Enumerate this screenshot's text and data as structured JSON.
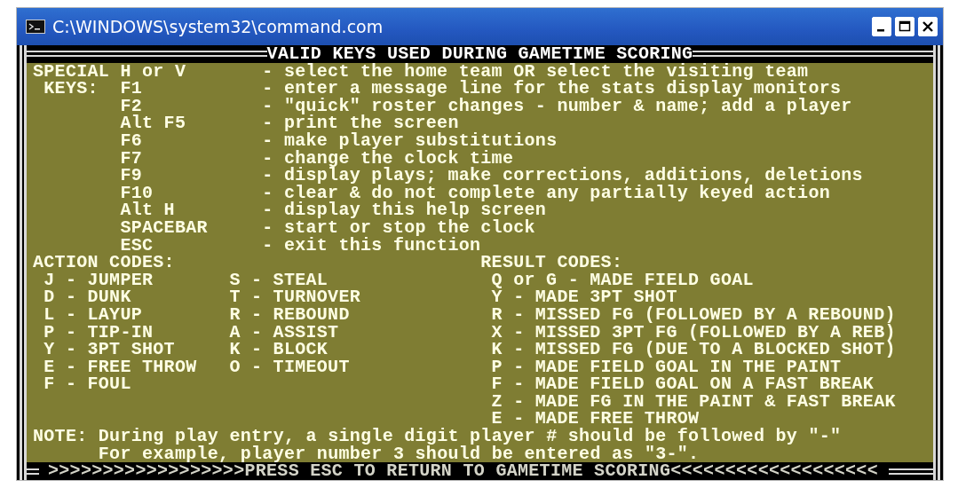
{
  "window": {
    "title": "C:\\WINDOWS\\system32\\command.com"
  },
  "screen": {
    "heading": "VALID KEYS USED DURING GAMETIME SCORING",
    "special_keys": {
      "label_lines": [
        "SPECIAL",
        "KEYS:"
      ],
      "rows": [
        {
          "key": "H or V",
          "description": "- select the home team OR select the visiting team"
        },
        {
          "key": "F1",
          "description": "- enter a message line for the stats display monitors"
        },
        {
          "key": "F2",
          "description": "- \"quick\" roster changes - number & name; add a player"
        },
        {
          "key": "Alt F5",
          "description": "- print the screen"
        },
        {
          "key": "F6",
          "description": "- make player substitutions"
        },
        {
          "key": "F7",
          "description": "- change the clock time"
        },
        {
          "key": "F9",
          "description": "- display plays; make corrections, additions, deletions"
        },
        {
          "key": "F10",
          "description": "- clear & do not complete any partially keyed action"
        },
        {
          "key": "Alt H",
          "description": "- display this help screen"
        },
        {
          "key": "SPACEBAR",
          "description": "- start or stop the clock"
        },
        {
          "key": "ESC",
          "description": "- exit this function"
        }
      ]
    },
    "action_codes": {
      "heading": "ACTION CODES:",
      "column_1": [
        "J - JUMPER",
        "D - DUNK",
        "L - LAYUP",
        "P - TIP-IN",
        "Y - 3PT SHOT",
        "E - FREE THROW",
        "F - FOUL"
      ],
      "column_2": [
        "S - STEAL",
        "T - TURNOVER",
        "R - REBOUND",
        "A - ASSIST",
        "K - BLOCK",
        "O - TIMEOUT"
      ]
    },
    "result_codes": {
      "heading": "RESULT CODES:",
      "items": [
        "Q or G - MADE FIELD GOAL",
        "Y - MADE 3PT SHOT",
        "R - MISSED FG (FOLLOWED BY A REBOUND)",
        "X - MISSED 3PT FG (FOLLOWED BY A REB)",
        "K - MISSED FG (DUE TO A BLOCKED SHOT)",
        "P - MADE FIELD GOAL IN THE PAINT",
        "F - MADE FIELD GOAL ON A FAST BREAK",
        "Z - MADE FG IN THE PAINT & FAST BREAK",
        "E - MADE FREE THROW"
      ]
    },
    "note": {
      "label": "NOTE:",
      "lines": [
        "During play entry, a single digit player # should be followed by \"-\"",
        "For example, player number 3 should be entered as \"3-\"."
      ]
    },
    "footer": ">>>>>>>>>>>>>>>>>>PRESS ESC TO RETURN TO GAMETIME SCORING<<<<<<<<<<<<<<<<<<<"
  }
}
